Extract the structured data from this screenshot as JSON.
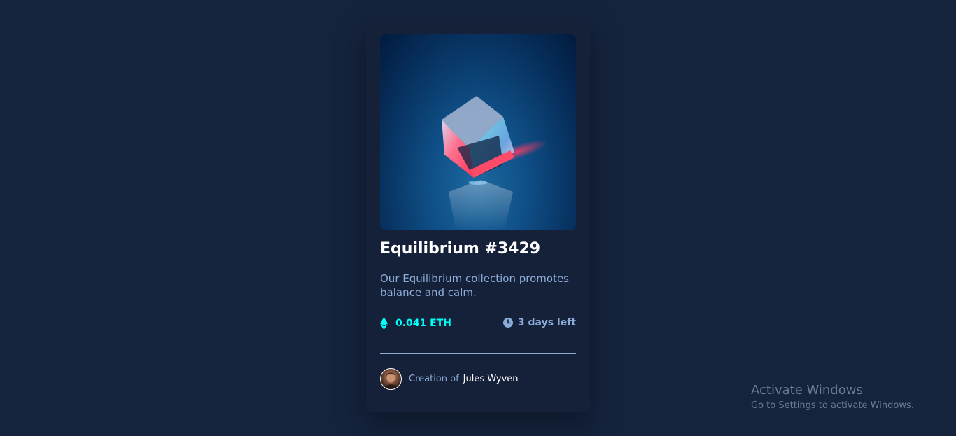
{
  "card": {
    "title": "Equilibrium #3429",
    "description": "Our Equilibrium collection promotes balance and calm.",
    "price": "0.041 ETH",
    "time_left": "3 days left",
    "creator_prefix": "Creation of",
    "creator_name": "Jules Wyven"
  },
  "watermark": {
    "title": "Activate Windows",
    "subtitle": "Go to Settings to activate Windows."
  },
  "icons": {
    "price": "ethereum-icon",
    "time": "clock-icon",
    "hero": "cube-image",
    "creator": "avatar"
  },
  "colors": {
    "page_bg": "#15233d",
    "card_bg": "#152039",
    "accent_cyan": "#00fff8",
    "soft_blue": "#8bacd9",
    "white": "#ffffff"
  }
}
